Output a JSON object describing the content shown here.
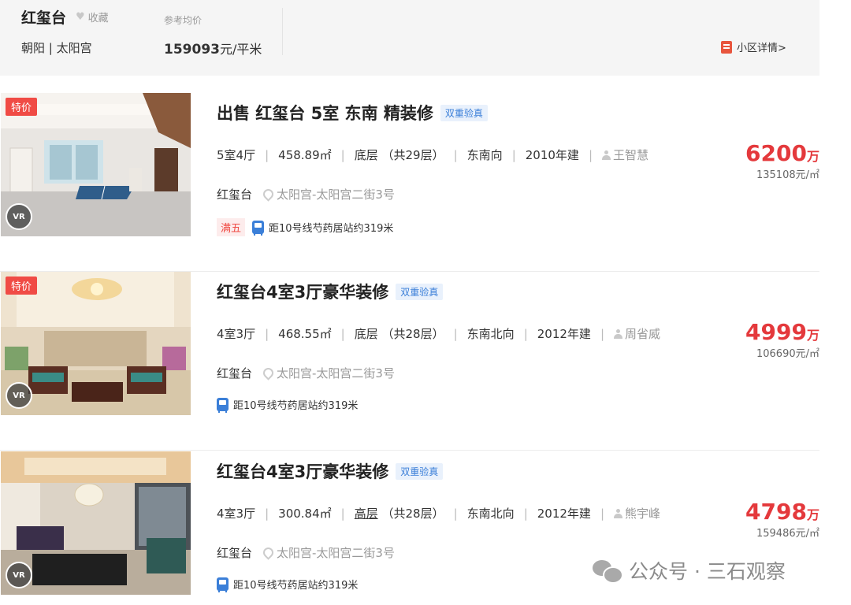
{
  "community": {
    "name": "红玺台",
    "favorite_label": "收藏",
    "location": "朝阳 | 太阳宫",
    "avg_price_label": "参考均价",
    "avg_price_value": "159093",
    "avg_price_unit": "元/平米",
    "detail_link": "小区详情>"
  },
  "listings": [
    {
      "badge": "特价",
      "title": "出售 红玺台 5室 东南 精装修",
      "verify": "双重验真",
      "layout": "5室4厅",
      "area": "458.89㎡",
      "floor_level": "底层",
      "floor_total": "（共29层）",
      "orientation": "东南向",
      "year": "2010年建",
      "agent": "王智慧",
      "community": "红玺台",
      "address": "太阳宫-太阳宫二街3号",
      "tag": "满五",
      "subway": "距10号线芍药居站约319米",
      "total_price": "6200",
      "price_unit": "万",
      "unit_price": "135108元/㎡",
      "vr": "VR"
    },
    {
      "badge": "特价",
      "title": "红玺台4室3厅豪华装修",
      "verify": "双重验真",
      "layout": "4室3厅",
      "area": "468.55㎡",
      "floor_level": "底层",
      "floor_total": "（共28层）",
      "orientation": "东南北向",
      "year": "2012年建",
      "agent": "周省威",
      "community": "红玺台",
      "address": "太阳宫-太阳宫二街3号",
      "tag": "",
      "subway": "距10号线芍药居站约319米",
      "total_price": "4999",
      "price_unit": "万",
      "unit_price": "106690元/㎡",
      "vr": "VR"
    },
    {
      "badge": "",
      "title": "红玺台4室3厅豪华装修",
      "verify": "双重验真",
      "layout": "4室3厅",
      "area": "300.84㎡",
      "floor_level": "高层",
      "floor_total": "（共28层）",
      "orientation": "东南北向",
      "year": "2012年建",
      "agent": "熊宇峰",
      "community": "红玺台",
      "address": "太阳宫-太阳宫二街3号",
      "tag": "",
      "subway": "距10号线芍药居站约319米",
      "total_price": "4798",
      "price_unit": "万",
      "unit_price": "159486元/㎡",
      "vr": "VR"
    }
  ],
  "watermark": "公众号 · 三石观察",
  "colors": {
    "price_red": "#e4393c",
    "badge_red": "#f04b45",
    "verify_blue": "#3b7fd8",
    "header_bg": "#f5f5f5"
  }
}
